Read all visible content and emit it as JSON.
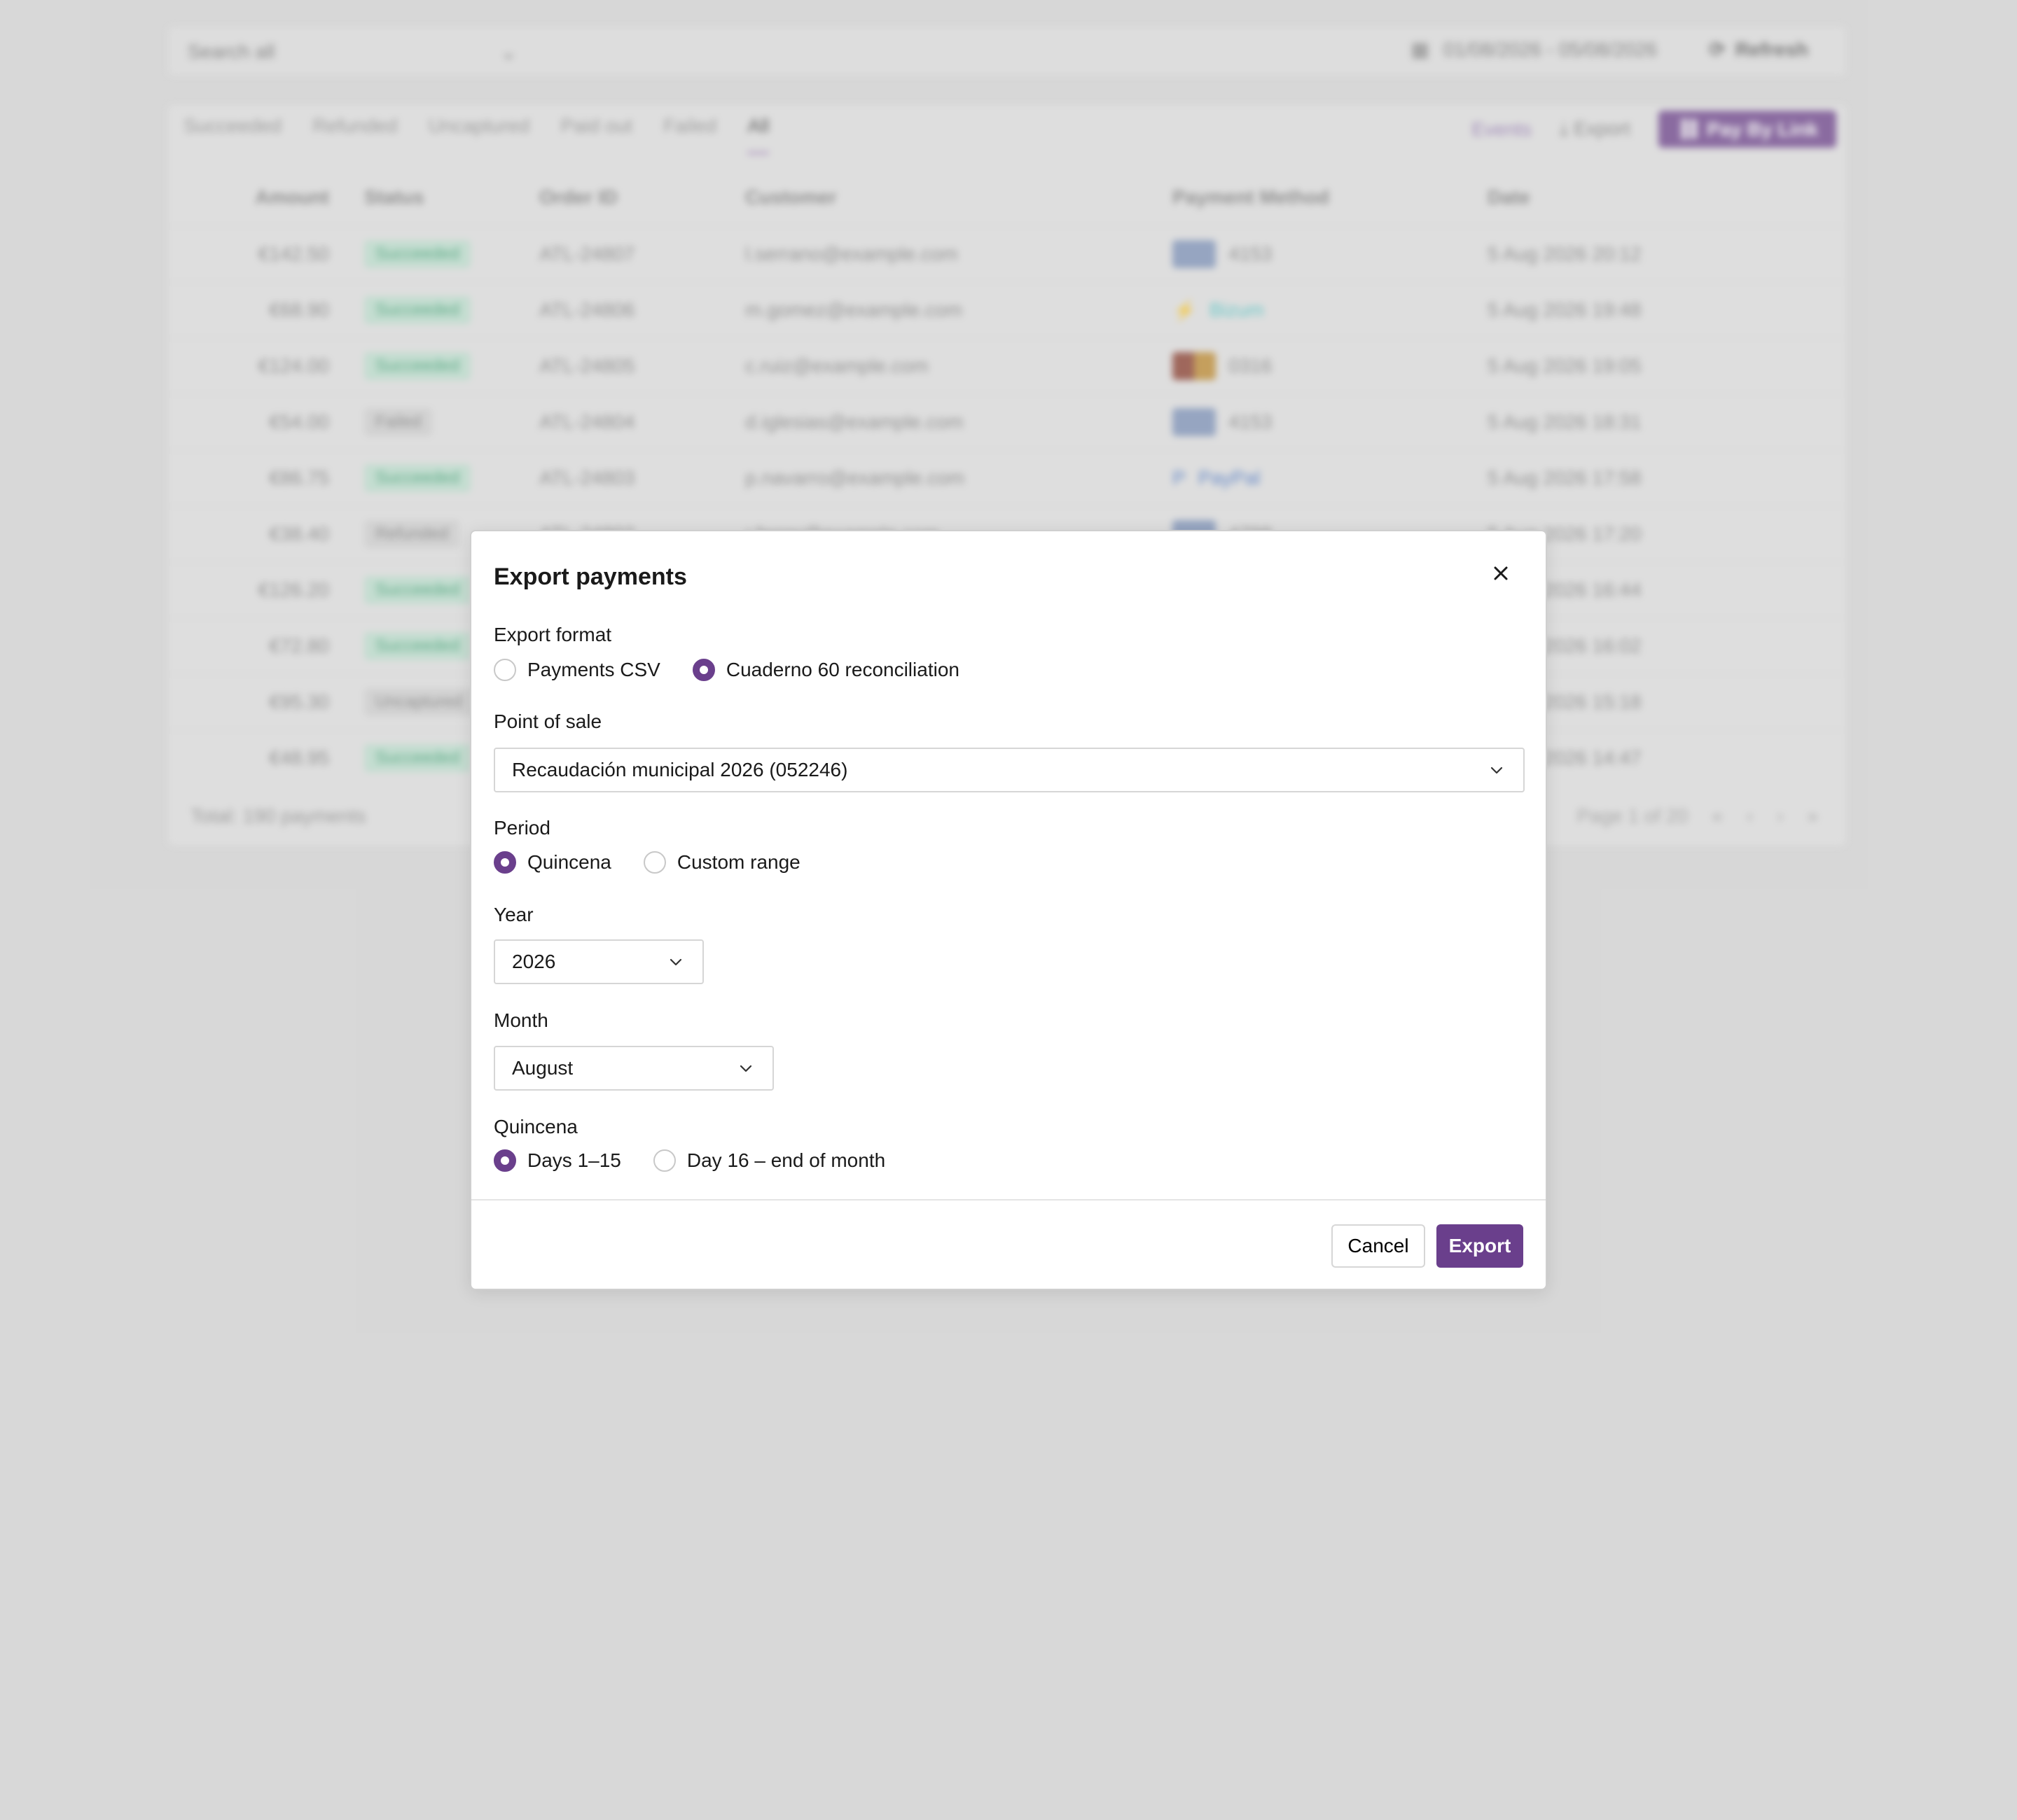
{
  "background": {
    "search_placeholder": "Search all",
    "date_range": "01/08/2026 - 05/08/2026",
    "refresh_label": "Refresh",
    "tabs": [
      "Succeeded",
      "Refunded",
      "Uncaptured",
      "Paid out",
      "Failed",
      "All"
    ],
    "actions": {
      "events": "Events",
      "export": "Export",
      "pay_by_link": "Pay By Link"
    },
    "columns": [
      "Amount",
      "Status",
      "Order ID",
      "Customer",
      "Payment Method",
      "Date"
    ],
    "rows": [
      {
        "amount": "€142.50",
        "status": "Succeeded",
        "order": "ATL-24807",
        "customer": "l.serrano@example.com",
        "pm": "4153",
        "date": "5 Aug 2026 20:12"
      },
      {
        "amount": "€68.90",
        "status": "Succeeded",
        "order": "ATL-24806",
        "customer": "m.gomez@example.com",
        "pm": "Bizum",
        "date": "5 Aug 2026 19:48"
      },
      {
        "amount": "€124.00",
        "status": "Succeeded",
        "order": "ATL-24805",
        "customer": "c.ruiz@example.com",
        "pm": "0316",
        "date": "5 Aug 2026 19:05"
      },
      {
        "amount": "€54.00",
        "status": "Failed",
        "order": "ATL-24804",
        "customer": "d.iglesias@example.com",
        "pm": "4153",
        "date": "5 Aug 2026 18:31"
      },
      {
        "amount": "€86.75",
        "status": "Succeeded",
        "order": "ATL-24803",
        "customer": "p.navarro@example.com",
        "pm": "PayPal",
        "date": "5 Aug 2026 17:58"
      },
      {
        "amount": "€38.40",
        "status": "Refunded",
        "order": "ATL-24802",
        "customer": "r.ferrer@example.com",
        "pm": "4798",
        "date": "5 Aug 2026 17:20"
      },
      {
        "amount": "€126.20",
        "status": "Succeeded",
        "order": "",
        "customer": "",
        "pm": "",
        "date": "5 Aug 2026 16:44"
      },
      {
        "amount": "€72.80",
        "status": "Succeeded",
        "order": "",
        "customer": "",
        "pm": "",
        "date": "5 Aug 2026 16:02"
      },
      {
        "amount": "€95.30",
        "status": "Uncaptured",
        "order": "",
        "customer": "",
        "pm": "",
        "date": "5 Aug 2026 15:18"
      },
      {
        "amount": "€48.95",
        "status": "Succeeded",
        "order": "",
        "customer": "",
        "pm": "",
        "date": "5 Aug 2026 14:47"
      }
    ],
    "total_label": "Total: 190 payments",
    "page_label": "Page 1 of 20"
  },
  "modal": {
    "title": "Export payments",
    "export_format": {
      "label": "Export format",
      "options": [
        "Payments CSV",
        "Cuaderno 60 reconciliation"
      ],
      "selected": "Cuaderno 60 reconciliation"
    },
    "point_of_sale": {
      "label": "Point of sale",
      "value": "Recaudación municipal 2026 (052246)"
    },
    "period": {
      "label": "Period",
      "options": [
        "Quincena",
        "Custom range"
      ],
      "selected": "Quincena"
    },
    "year": {
      "label": "Year",
      "value": "2026"
    },
    "month": {
      "label": "Month",
      "value": "August"
    },
    "quincena": {
      "label": "Quincena",
      "options": [
        "Days 1–15",
        "Day 16 – end of month"
      ],
      "selected": "Days 1–15"
    },
    "cancel_label": "Cancel",
    "export_label": "Export"
  },
  "colors": {
    "accent": "#6a3f8c",
    "success": "#2f9d6a"
  },
  "icons": [
    "close-icon",
    "chevron-down-icon",
    "calendar-icon",
    "refresh-icon",
    "download-icon",
    "link-icon"
  ]
}
